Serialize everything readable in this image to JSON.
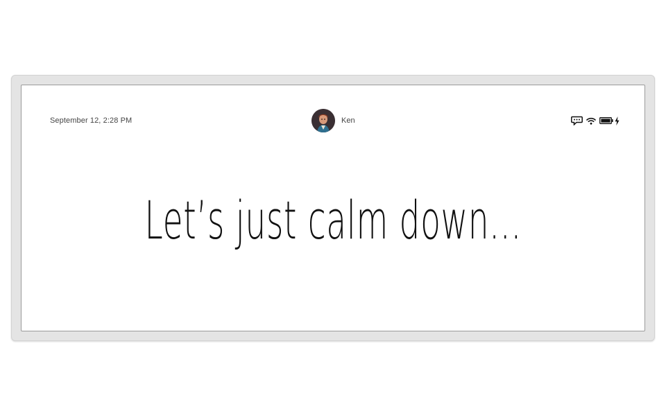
{
  "status_bar": {
    "datetime": "September 12, 2:28 PM",
    "user": {
      "name": "Ken",
      "avatar_icon": "user-avatar"
    },
    "icons": [
      "message-icon",
      "wifi-icon",
      "battery-icon",
      "charging-bolt-icon"
    ]
  },
  "main": {
    "message": "Let’s just calm down..."
  },
  "colors": {
    "frame": "#e4e4e4",
    "screen": "#ffffff",
    "text": "#111111",
    "status_text": "#444444"
  }
}
